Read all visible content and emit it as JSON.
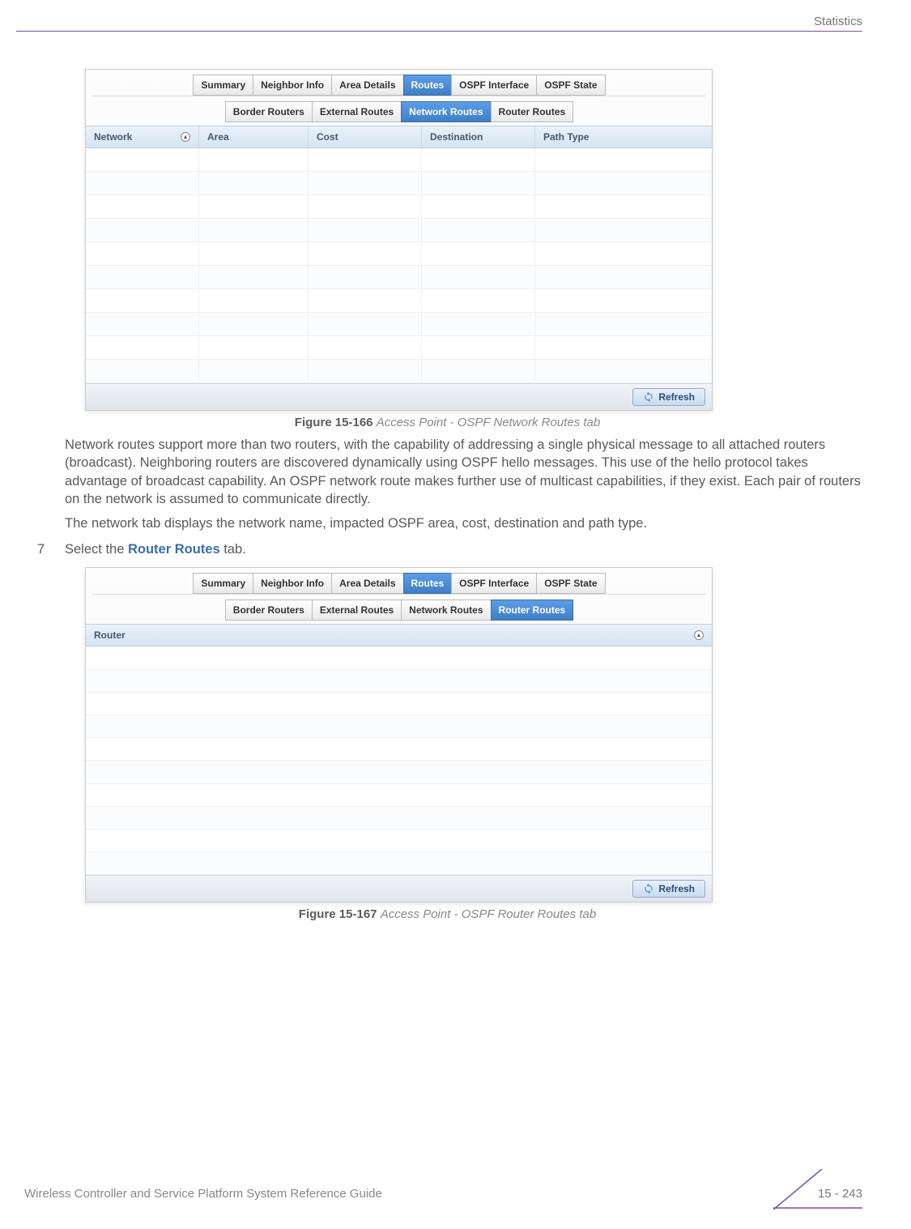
{
  "header": {
    "section": "Statistics"
  },
  "figure1": {
    "tabs_main": [
      "Summary",
      "Neighbor Info",
      "Area Details",
      "Routes",
      "OSPF Interface",
      "OSPF State"
    ],
    "tabs_main_active": "Routes",
    "tabs_sub": [
      "Border Routers",
      "External Routes",
      "Network Routes",
      "Router Routes"
    ],
    "tabs_sub_active": "Network Routes",
    "columns": [
      "Network",
      "Area",
      "Cost",
      "Destination",
      "Path Type"
    ],
    "refresh": "Refresh",
    "caption_label": "Figure 15-166",
    "caption_text": "Access Point - OSPF Network Routes tab"
  },
  "paragraphs": {
    "p1": "Network routes support more than two routers, with the capability of addressing a single physical message to all attached routers (broadcast). Neighboring routers are discovered dynamically using OSPF hello messages. This use of the hello protocol takes advantage of broadcast capability. An OSPF network route makes further use of multicast capabilities, if they exist. Each pair of routers on the network is assumed to communicate directly.",
    "p2": "The network tab displays the network name, impacted OSPF area, cost, destination and path type."
  },
  "step": {
    "number": "7",
    "prefix": "Select the ",
    "ref": "Router Routes",
    "suffix": " tab."
  },
  "figure2": {
    "tabs_main": [
      "Summary",
      "Neighbor Info",
      "Area Details",
      "Routes",
      "OSPF Interface",
      "OSPF State"
    ],
    "tabs_main_active": "Routes",
    "tabs_sub": [
      "Border Routers",
      "External Routes",
      "Network Routes",
      "Router Routes"
    ],
    "tabs_sub_active": "Router Routes",
    "columns": [
      "Router"
    ],
    "refresh": "Refresh",
    "caption_label": "Figure 15-167",
    "caption_text": "Access Point - OSPF Router Routes tab"
  },
  "footer": {
    "doc_title": "Wireless Controller and Service Platform System Reference Guide",
    "page": "15 - 243"
  }
}
